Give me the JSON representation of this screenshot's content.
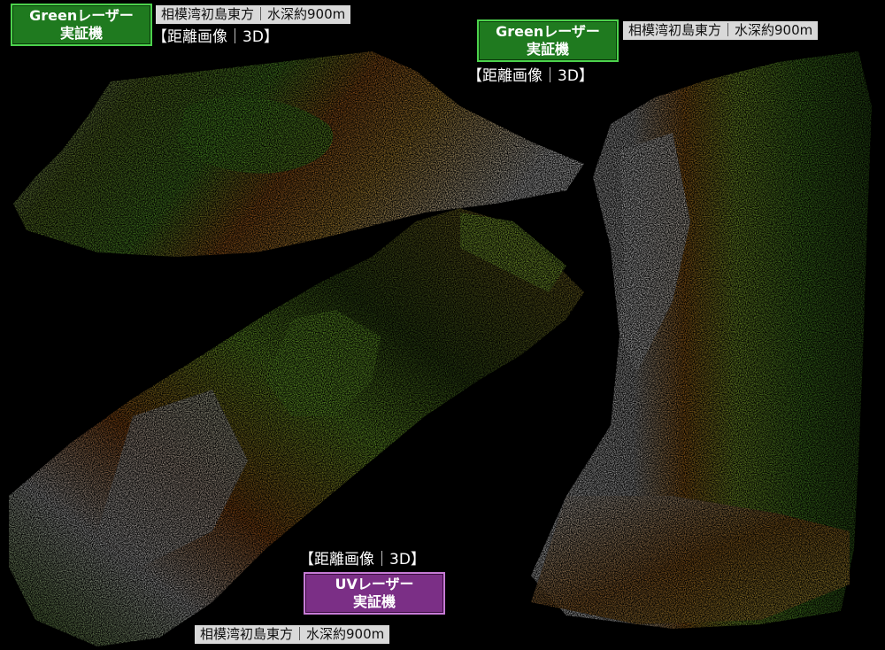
{
  "top_left": {
    "badge_line1": "Greenレーザー",
    "badge_line2": "実証機",
    "location": "相模湾初島東方｜水深約900m",
    "caption": "【距離画像｜3D】"
  },
  "top_right": {
    "badge_line1": "Greenレーザー",
    "badge_line2": "実証機",
    "location": "相模湾初島東方｜水深約900m",
    "caption": "【距離画像｜3D】"
  },
  "bottom_center": {
    "caption": "【距離画像｜3D】",
    "badge_line1": "UVレーザー",
    "badge_line2": "実証機",
    "location": "相模湾初島東方｜水深約900m"
  },
  "colors": {
    "green_badge": "#1f7a1f",
    "purple_badge": "#7b2f86",
    "location_bg": "#d9d9d9"
  }
}
